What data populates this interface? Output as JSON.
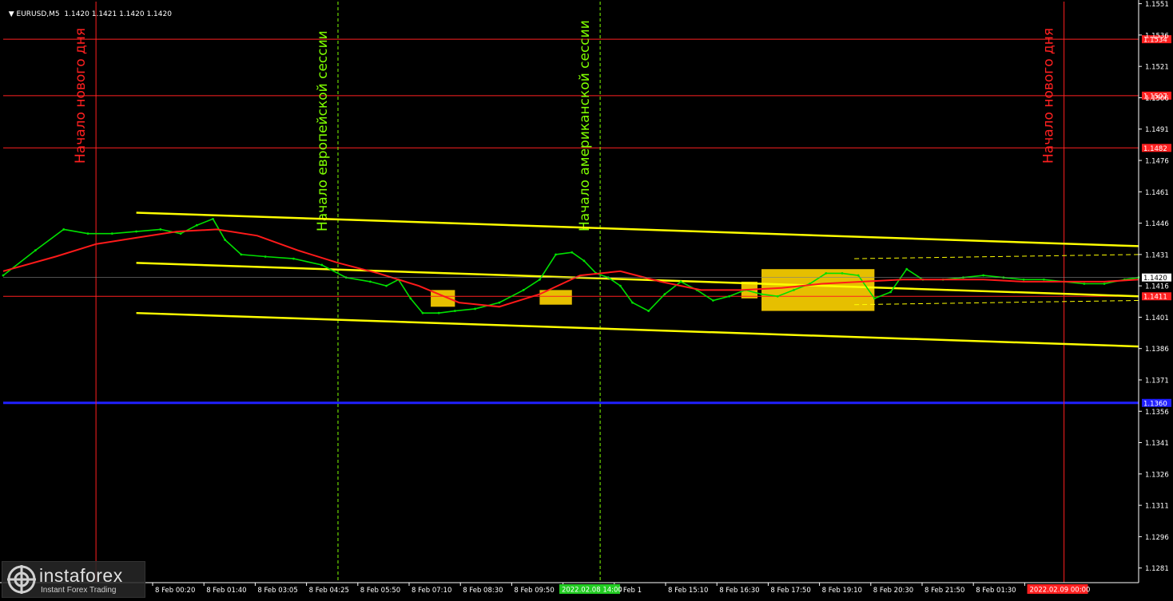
{
  "header": {
    "symbol": "EURUSD,M5",
    "ohlc": "1.1420 1.1421 1.1420 1.1420"
  },
  "watermark": {
    "name": "instaforex",
    "tagline": "Instant Forex Trading"
  },
  "colors": {
    "background": "#000000",
    "price": "#00e000",
    "moving_average": "#ff1a1a",
    "channel": "#ffff00",
    "level_red": "#ff2020",
    "level_blue": "#2020ff",
    "session_green": "#7fff00",
    "day_red": "#ff2020",
    "highlight": "#ffd400",
    "axis_text": "#ffffff"
  },
  "chart_data": {
    "type": "line",
    "title": "EURUSD,M5",
    "ylim": [
      1.1274,
      1.1552
    ],
    "y_ticks": [
      "1.1551",
      "1.1536",
      "1.1521",
      "1.1506",
      "1.1491",
      "1.1476",
      "1.1461",
      "1.1446",
      "1.1431",
      "1.1416",
      "1.1401",
      "1.1386",
      "1.1371",
      "1.1356",
      "1.1341",
      "1.1326",
      "1.1311",
      "1.1296",
      "1.1281"
    ],
    "x_ticks": [
      "8 Feb 00:20",
      "8 Feb 01:40",
      "8 Feb 03:05",
      "8 Feb 04:25",
      "8 Feb 05:50",
      "8 Feb 07:10",
      "8 Feb 08:30",
      "8 Feb 09:50",
      "8 Feb 11:10",
      "8 Feb 1",
      "8 Feb 15:10",
      "8 Feb 16:30",
      "8 Feb 17:50",
      "8 Feb 19:10",
      "8 Feb 20:30",
      "8 Feb 21:50",
      "8 Feb 01:30",
      "9 Feb 01:50"
    ],
    "x_range_hours": [
      -2.3,
      25.85
    ],
    "current_price": "1.1420",
    "series": [
      {
        "name": "EURUSD",
        "color": "#00e000",
        "x_hours": [
          -2.3,
          -1.5,
          -0.8,
          -0.2,
          0.4,
          1.0,
          1.6,
          2.1,
          2.5,
          2.9,
          3.2,
          3.6,
          4.2,
          4.9,
          5.6,
          6.2,
          6.8,
          7.2,
          7.5,
          7.8,
          8.1,
          8.5,
          8.9,
          9.4,
          10.0,
          10.6,
          11.0,
          11.4,
          11.8,
          12.1,
          12.4,
          12.7,
          13.0,
          13.3,
          13.7,
          14.1,
          14.5,
          14.9,
          15.3,
          15.7,
          16.1,
          16.5,
          16.9,
          17.3,
          17.7,
          18.1,
          18.5,
          18.9,
          19.3,
          19.7,
          20.1,
          20.5,
          21.0,
          21.5,
          22.0,
          22.5,
          23.0,
          23.5,
          24.0,
          24.5,
          25.0,
          25.5,
          25.85
        ],
        "values": [
          1.1421,
          1.1433,
          1.1443,
          1.1441,
          1.1441,
          1.1442,
          1.1443,
          1.1441,
          1.1445,
          1.1448,
          1.1438,
          1.1431,
          1.143,
          1.1429,
          1.1426,
          1.142,
          1.1418,
          1.1416,
          1.1419,
          1.141,
          1.1403,
          1.1403,
          1.1404,
          1.1405,
          1.1408,
          1.1414,
          1.1419,
          1.1431,
          1.1432,
          1.1428,
          1.1422,
          1.142,
          1.1416,
          1.1408,
          1.1404,
          1.1412,
          1.1418,
          1.1414,
          1.1409,
          1.1411,
          1.1414,
          1.1412,
          1.1411,
          1.1414,
          1.1417,
          1.1422,
          1.1422,
          1.1421,
          1.141,
          1.1413,
          1.1424,
          1.1419,
          1.1419,
          1.142,
          1.1421,
          1.142,
          1.1419,
          1.1419,
          1.1418,
          1.1417,
          1.1417,
          1.1419,
          1.142
        ]
      },
      {
        "name": "MA",
        "color": "#ff1a1a",
        "x_hours": [
          -2.3,
          -1.0,
          0.0,
          1.0,
          2.0,
          3.0,
          4.0,
          5.0,
          6.0,
          7.0,
          8.0,
          9.0,
          10.0,
          11.0,
          12.0,
          13.0,
          14.0,
          15.0,
          16.0,
          17.0,
          18.0,
          19.0,
          20.0,
          21.0,
          22.0,
          23.0,
          24.0,
          25.0,
          25.85
        ],
        "values": [
          1.1423,
          1.143,
          1.1436,
          1.1439,
          1.1442,
          1.1443,
          1.144,
          1.1433,
          1.1427,
          1.1422,
          1.1416,
          1.1408,
          1.1406,
          1.1412,
          1.1421,
          1.1423,
          1.1418,
          1.1414,
          1.1414,
          1.1415,
          1.1417,
          1.1418,
          1.1419,
          1.1419,
          1.1419,
          1.1418,
          1.1418,
          1.1418,
          1.1419
        ]
      }
    ],
    "trend_lines": [
      {
        "name": "channel-upper",
        "x_hours": [
          1.0,
          25.85
        ],
        "values": [
          1.1451,
          1.1435
        ]
      },
      {
        "name": "channel-middle",
        "x_hours": [
          1.0,
          25.85
        ],
        "values": [
          1.1427,
          1.1411
        ]
      },
      {
        "name": "channel-lower",
        "x_hours": [
          1.0,
          25.85
        ],
        "values": [
          1.1403,
          1.1387
        ]
      }
    ],
    "dashed_lines": [
      {
        "x_hours": [
          18.8,
          25.85
        ],
        "values": [
          1.1429,
          1.1431
        ]
      },
      {
        "x_hours": [
          18.8,
          25.85
        ],
        "values": [
          1.1407,
          1.1409
        ]
      }
    ],
    "levels": [
      {
        "label": "1.1534",
        "value": 1.1534,
        "color": "#ff2020"
      },
      {
        "label": "1.1507",
        "value": 1.1507,
        "color": "#ff2020"
      },
      {
        "label": "1.1482",
        "value": 1.1482,
        "color": "#ff2020"
      },
      {
        "label": "1.1411",
        "value": 1.1411,
        "color": "#ff2020"
      },
      {
        "label": "1.1360",
        "value": 1.136,
        "color": "#2020ff"
      }
    ],
    "highlight_zones": [
      {
        "x_hours": [
          8.3,
          8.9
        ],
        "values": [
          1.1406,
          1.1414
        ]
      },
      {
        "x_hours": [
          11.0,
          11.8
        ],
        "values": [
          1.1407,
          1.1414
        ]
      },
      {
        "x_hours": [
          16.0,
          16.4
        ],
        "values": [
          1.141,
          1.1418
        ]
      },
      {
        "x_hours": [
          16.5,
          19.3
        ],
        "values": [
          1.1404,
          1.1424
        ]
      }
    ],
    "vertical_markers": [
      {
        "x_hours": 0.0,
        "label": "Начало нового дня",
        "color": "#ff2020",
        "style": "solid"
      },
      {
        "x_hours": 6.0,
        "label": "Начало европейской сессии",
        "color": "#7fff00",
        "style": "dashed"
      },
      {
        "x_hours": 12.5,
        "label": "Начало американской сессии",
        "color": "#7fff00",
        "style": "dashed"
      },
      {
        "x_hours": 24.0,
        "label": "Начало нового дня",
        "color": "#ff2020",
        "style": "solid"
      }
    ],
    "time_badges": [
      {
        "x_hours": 12.2,
        "text": "2022.02.08 14:00",
        "color": "#22cc22"
      },
      {
        "x_hours": 23.8,
        "text": "2022.02.09 00:00",
        "color": "#ff2020"
      }
    ]
  }
}
